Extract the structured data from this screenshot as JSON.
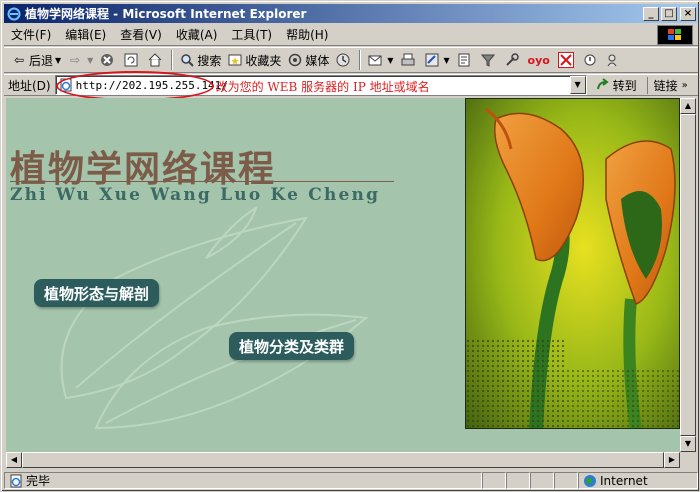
{
  "window": {
    "title": "植物学网络课程 - Microsoft Internet Explorer",
    "controls": {
      "minimize": "_",
      "maximize": "□",
      "close": "×"
    }
  },
  "menu": [
    "文件(F)",
    "编辑(E)",
    "查看(V)",
    "收藏(A)",
    "工具(T)",
    "帮助(H)"
  ],
  "toolbar": {
    "back": "后退",
    "search": "搜索",
    "favorites": "收藏夹",
    "media": "媒体"
  },
  "address": {
    "label": "地址(D)",
    "url": "http://202.195.255.141/",
    "annotation": "改为您的 WEB 服务器的 IP 地址或域名",
    "go": "转到",
    "links": "链接"
  },
  "page": {
    "title_cn": "植物学网络课程",
    "title_pinyin": "Zhi Wu Xue Wang Luo Ke Cheng",
    "nav": [
      "植物形态与解剖",
      "植物分类及类群"
    ],
    "colors": {
      "background": "#a4c4ac",
      "title": "#7c5c48",
      "pinyin": "#3c6a64",
      "button": "#2c5c5c"
    }
  },
  "status": {
    "text": "完毕",
    "zone": "Internet"
  }
}
